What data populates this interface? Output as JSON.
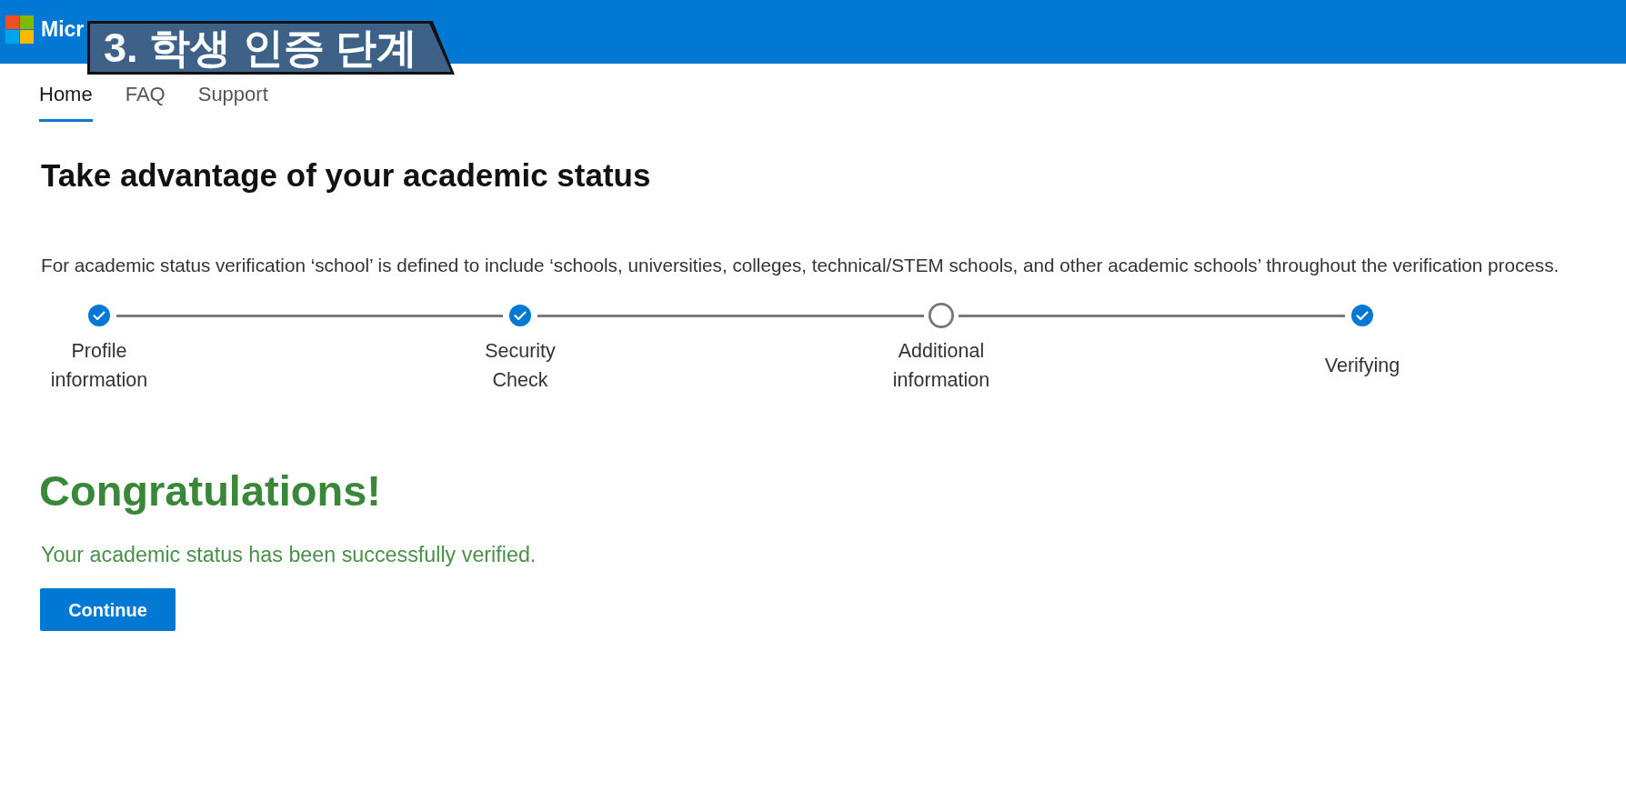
{
  "header": {
    "logo_text": "Micr"
  },
  "caption": {
    "text": "3. 학생 인증 단계"
  },
  "nav": [
    {
      "label": "Home",
      "selected": true
    },
    {
      "label": "FAQ",
      "selected": false
    },
    {
      "label": "Support",
      "selected": false
    }
  ],
  "title": "Take advantage of your academic status",
  "description": "For academic status verification ‘school’ is defined to include ‘schools, universities, colleges, technical/STEM schools, and other academic schools’ throughout the verification process.",
  "steps": [
    {
      "label": "Profile information",
      "completed": true
    },
    {
      "label": "Security Check",
      "completed": true
    },
    {
      "label": "Additional information",
      "completed": false
    },
    {
      "label": "Verifying",
      "completed": true
    }
  ],
  "result": {
    "heading": "Congratulations!",
    "message": "Your academic status has been successfully verified.",
    "button": "Continue"
  }
}
